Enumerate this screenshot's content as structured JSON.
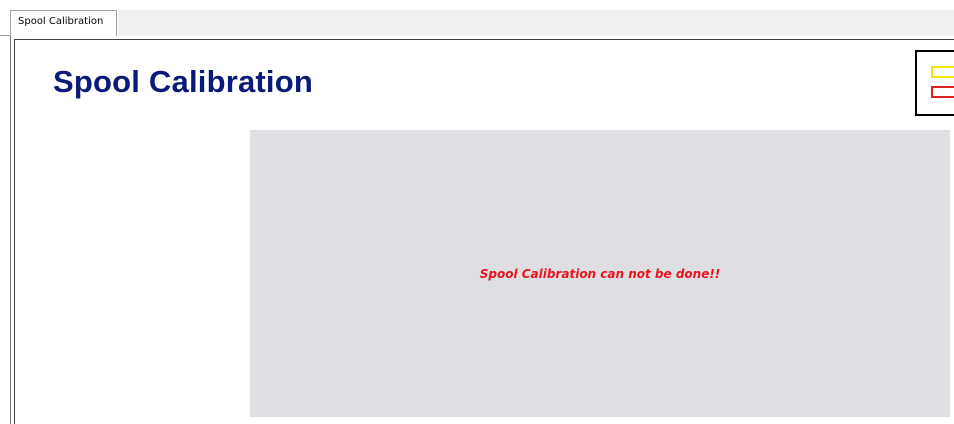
{
  "tabs": [
    {
      "label": "Spool Calibration",
      "active": true
    }
  ],
  "page": {
    "title": "Spool Calibration",
    "logo": {
      "name": "company-logo-icon",
      "colors": [
        "#f5e600",
        "#e02020",
        "#000000"
      ]
    },
    "message": "Spool Calibration can not be done!!"
  },
  "colors": {
    "title": "#0a1a7a",
    "message": "#e8141e",
    "panel_background": "#dfdfe3"
  }
}
